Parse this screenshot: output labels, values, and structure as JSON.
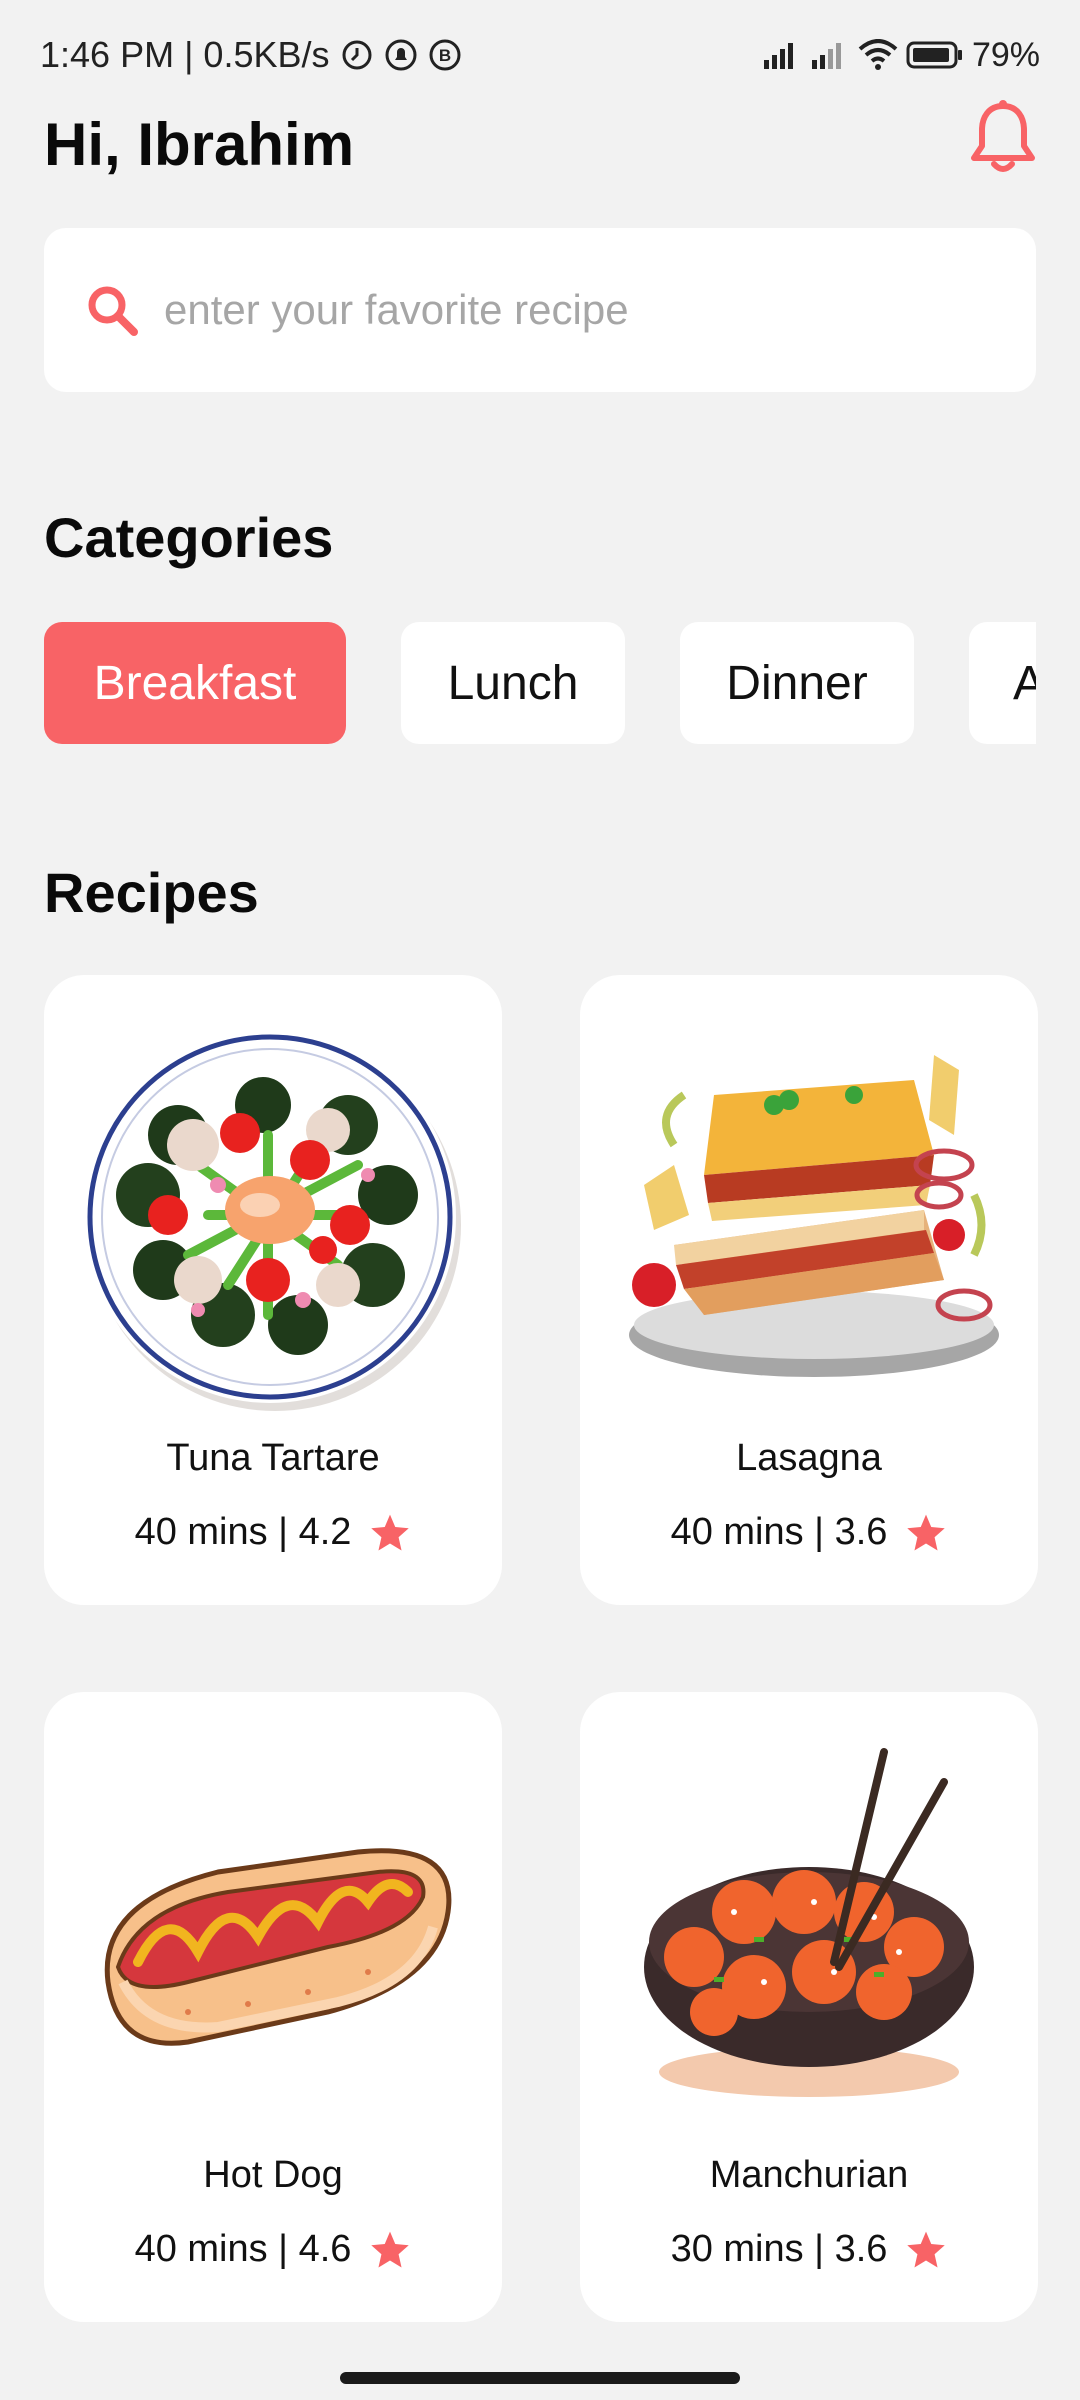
{
  "status": {
    "time_text": "1:46 PM | 0.5KB/s",
    "battery_text": "79%"
  },
  "header": {
    "greeting": "Hi, Ibrahim",
    "bell_icon": "bell-icon"
  },
  "search": {
    "placeholder": "enter your favorite recipe",
    "icon": "search-icon"
  },
  "categories": {
    "title": "Categories",
    "items": [
      "Breakfast",
      "Lunch",
      "Dinner",
      "A"
    ],
    "selected": "Breakfast"
  },
  "recipes": {
    "title": "Recipes",
    "items": [
      {
        "name": "Tuna Tartare",
        "meta": "40 mins | 4.2"
      },
      {
        "name": "Lasagna",
        "meta": "40 mins | 3.6"
      },
      {
        "name": "Hot Dog",
        "meta": "40 mins | 4.6"
      },
      {
        "name": "Manchurian",
        "meta": "30 mins | 3.6"
      }
    ]
  },
  "colors": {
    "accent": "#f86366",
    "background": "#f2f2f2",
    "card": "#ffffff"
  }
}
